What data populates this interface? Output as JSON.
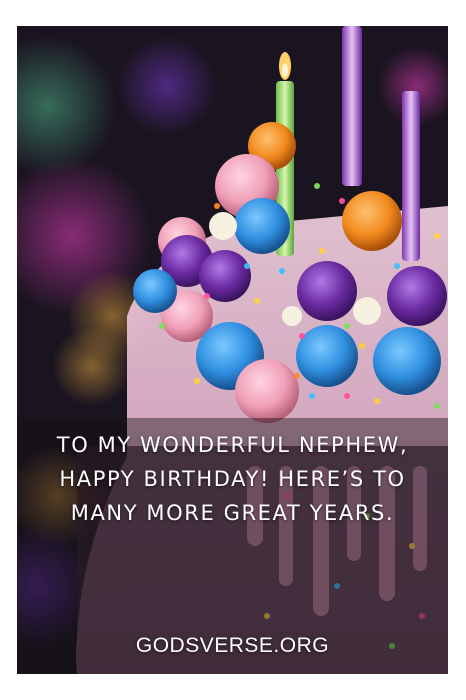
{
  "card": {
    "message": "To my wonderful nephew, Happy Birthday! Here’s to many more great years.",
    "website": "GODSVERSE.ORG"
  },
  "photo": {
    "subject": "birthday-cake",
    "colors": {
      "background": "#1a1420",
      "frosting": "#f2c6d8",
      "candle_green": "#8fd46a",
      "candle_purple": "#9b4fc8",
      "flame": "#ffd066",
      "ball_blue": "#2f8fe0",
      "ball_purple": "#6a2aa0",
      "ball_orange": "#f28a1e",
      "ball_pink": "#f0a0b8"
    }
  }
}
